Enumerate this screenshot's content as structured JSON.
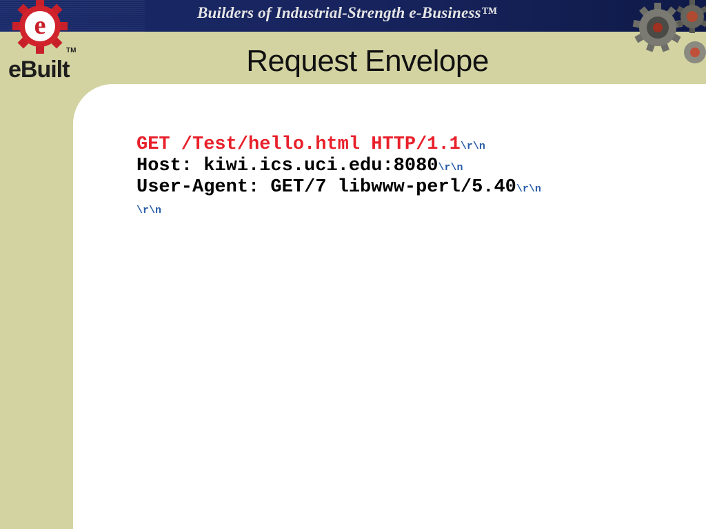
{
  "header": {
    "tagline": "Builders of Industrial-Strength e-Business™"
  },
  "logo": {
    "brand": "eBuilt",
    "tm": "TM"
  },
  "slide": {
    "title": "Request Envelope"
  },
  "request": {
    "lines": [
      {
        "text": "GET /Test/hello.html HTTP/1.1",
        "crlf": "\\r\\n"
      },
      {
        "text": "Host: kiwi.ics.uci.edu:8080",
        "crlf": "\\r\\n"
      },
      {
        "text": "User-Agent: GET/7 libwww-perl/5.40",
        "crlf": "\\r\\n"
      }
    ],
    "terminator": "\\r\\n"
  },
  "colors": {
    "request_line": "#e8202a",
    "crlf": "#2a5ea8",
    "header_bar": "#1a2a6a",
    "panel": "#d3d3a2"
  }
}
